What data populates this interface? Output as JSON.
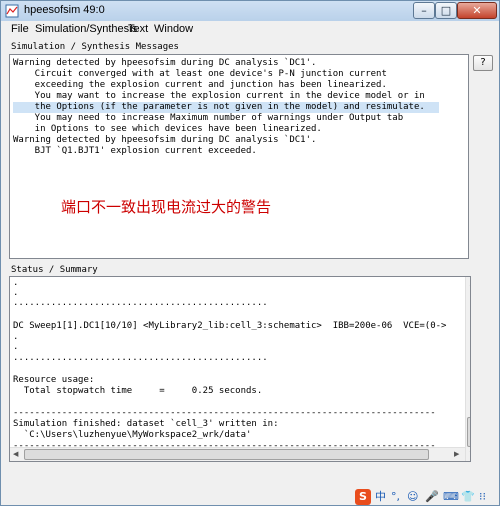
{
  "window": {
    "title": "hpeesofsim 49:0"
  },
  "window_controls": {
    "minimize": "–",
    "maximize": "□",
    "close": "✕"
  },
  "menu": {
    "file": "File",
    "simulation": "Simulation/Synthesis",
    "text": "Text",
    "window": "Window"
  },
  "messages": {
    "label": "Simulation / Synthesis Messages",
    "lines": [
      "Warning detected by hpeesofsim during DC analysis `DC1'.",
      "    Circuit converged with at least one device's P-N junction current",
      "    exceeding the explosion current and junction has been linearized.",
      "    You may want to increase the explosion current in the device model or in",
      "    the Options (if the parameter is not given in the model) and resimulate.",
      "    You may need to increase Maximum number of warnings under Output tab",
      "    in Options to see which devices have been linearized.",
      "Warning detected by hpeesofsim during DC analysis `DC1'.",
      "    BJT `Q1.BJT1' explosion current exceeded."
    ],
    "selected_line": 4
  },
  "annotation": {
    "text": "端口不一致出现电流过大的警告"
  },
  "help_button": {
    "label": "?"
  },
  "status": {
    "label": "Status / Summary",
    "lines": [
      ".",
      ".",
      "...............................................",
      "",
      "DC Sweep1[1].DC1[10/10] <MyLibrary2_lib:cell_3:schematic>  IBB=200e-06  VCE=(0->",
      ".",
      ".",
      "...............................................",
      "",
      "Resource usage:",
      "  Total stopwatch time     =     0.25 seconds.",
      "",
      "------------------------------------------------------------------------------",
      "Simulation finished: dataset `cell_3' written in:",
      "  `C:\\Users\\luzhenyue\\MyWorkspace2_wrk/data'",
      "------------------------------------------------------------------------------"
    ]
  },
  "taskbar": {
    "icons": [
      "S",
      "中",
      "°,",
      "☺",
      "🎤",
      "⌨",
      "👕",
      "⁝⁝"
    ]
  }
}
